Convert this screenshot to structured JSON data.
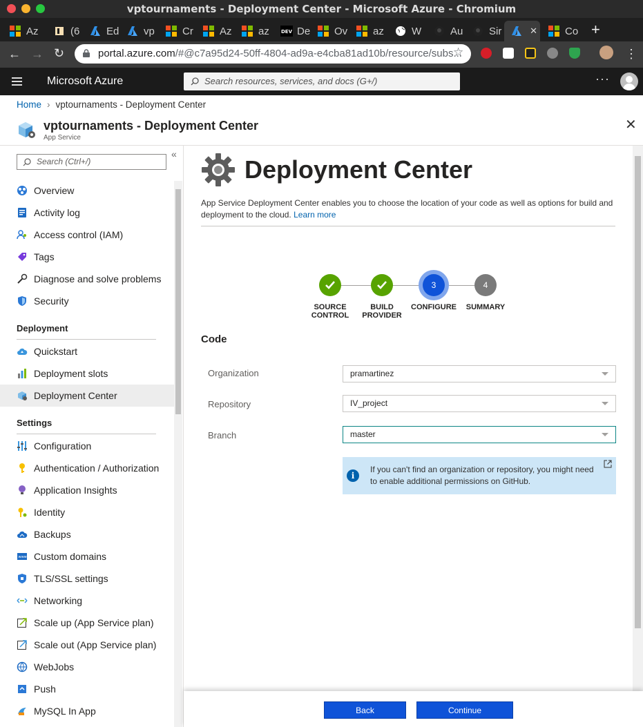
{
  "window": {
    "title": "vptournaments - Deployment Center - Microsoft Azure - Chromium"
  },
  "browser": {
    "tabs": [
      {
        "label": "Az",
        "icon": "microsoft-icon"
      },
      {
        "label": "(6",
        "icon": "slack-icon"
      },
      {
        "label": "Ed",
        "icon": "azure-icon"
      },
      {
        "label": "vp",
        "icon": "azure-icon"
      },
      {
        "label": "Cr",
        "icon": "microsoft-icon"
      },
      {
        "label": "Az",
        "icon": "microsoft-icon"
      },
      {
        "label": "az",
        "icon": "microsoft-icon"
      },
      {
        "label": "De",
        "icon": "dev-icon"
      },
      {
        "label": "Ov",
        "icon": "microsoft-icon"
      },
      {
        "label": "az",
        "icon": "microsoft-icon"
      },
      {
        "label": "W",
        "icon": "globe-icon"
      },
      {
        "label": "Au",
        "icon": "github-icon"
      },
      {
        "label": "Sir",
        "icon": "github-icon"
      },
      {
        "label": "",
        "icon": "azure-icon",
        "active": true
      },
      {
        "label": "Co",
        "icon": "microsoft-icon"
      }
    ],
    "url_host": "portal.azure.com",
    "url_rest": "/#@c7a95d24-50ff-4804-ad9a-e4cba81ad10b/resource/subs..."
  },
  "portal": {
    "brand": "Microsoft Azure",
    "search_placeholder": "Search resources, services, and docs (G+/)"
  },
  "breadcrumb": {
    "home": "Home",
    "current": "vptournaments - Deployment Center"
  },
  "blade": {
    "title": "vptournaments - Deployment Center",
    "subtitle": "App Service"
  },
  "menu": {
    "search_placeholder": "Search (Ctrl+/)",
    "items": [
      {
        "label": "Overview",
        "icon": "overview-icon"
      },
      {
        "label": "Activity log",
        "icon": "activity-log-icon"
      },
      {
        "label": "Access control (IAM)",
        "icon": "iam-icon"
      },
      {
        "label": "Tags",
        "icon": "tag-icon"
      },
      {
        "label": "Diagnose and solve problems",
        "icon": "wrench-icon"
      },
      {
        "label": "Security",
        "icon": "shield-icon"
      }
    ],
    "deployment_header": "Deployment",
    "deployment_items": [
      {
        "label": "Quickstart",
        "icon": "cloud-icon"
      },
      {
        "label": "Deployment slots",
        "icon": "slots-icon"
      },
      {
        "label": "Deployment Center",
        "icon": "deployment-center-icon",
        "selected": true
      }
    ],
    "settings_header": "Settings",
    "settings_items": [
      {
        "label": "Configuration",
        "icon": "sliders-icon"
      },
      {
        "label": "Authentication / Authorization",
        "icon": "key-icon"
      },
      {
        "label": "Application Insights",
        "icon": "lightbulb-icon"
      },
      {
        "label": "Identity",
        "icon": "identity-key-icon"
      },
      {
        "label": "Backups",
        "icon": "backup-cloud-icon"
      },
      {
        "label": "Custom domains",
        "icon": "domain-icon"
      },
      {
        "label": "TLS/SSL settings",
        "icon": "tls-shield-icon"
      },
      {
        "label": "Networking",
        "icon": "networking-icon"
      },
      {
        "label": "Scale up (App Service plan)",
        "icon": "scale-up-icon"
      },
      {
        "label": "Scale out (App Service plan)",
        "icon": "scale-out-icon"
      },
      {
        "label": "WebJobs",
        "icon": "webjobs-icon"
      },
      {
        "label": "Push",
        "icon": "push-icon"
      },
      {
        "label": "MySQL In App",
        "icon": "mysql-icon"
      }
    ]
  },
  "main": {
    "title": "Deployment Center",
    "description": "App Service Deployment Center enables you to choose the location of your code as well as options for build and deployment to the cloud.",
    "learn_more": "Learn more",
    "steps": [
      {
        "l1": "SOURCE",
        "l2": "CONTROL",
        "state": "done",
        "num": ""
      },
      {
        "l1": "BUILD",
        "l2": "PROVIDER",
        "state": "done",
        "num": ""
      },
      {
        "l1": "CONFIGURE",
        "l2": "",
        "state": "current",
        "num": "3"
      },
      {
        "l1": "SUMMARY",
        "l2": "",
        "state": "todo",
        "num": "4"
      }
    ],
    "code_header": "Code",
    "fields": [
      {
        "label": "Organization",
        "value": "pramartinez"
      },
      {
        "label": "Repository",
        "value": "IV_project"
      },
      {
        "label": "Branch",
        "value": "master"
      }
    ],
    "info": "If you can't find an organization or repository, you might need to enable additional permissions on GitHub."
  },
  "footer": {
    "back": "Back",
    "continue": "Continue"
  },
  "colors": {
    "accent": "#0f53d8",
    "success": "#57a300",
    "link": "#0062ad",
    "info_bg": "#cde6f7"
  }
}
